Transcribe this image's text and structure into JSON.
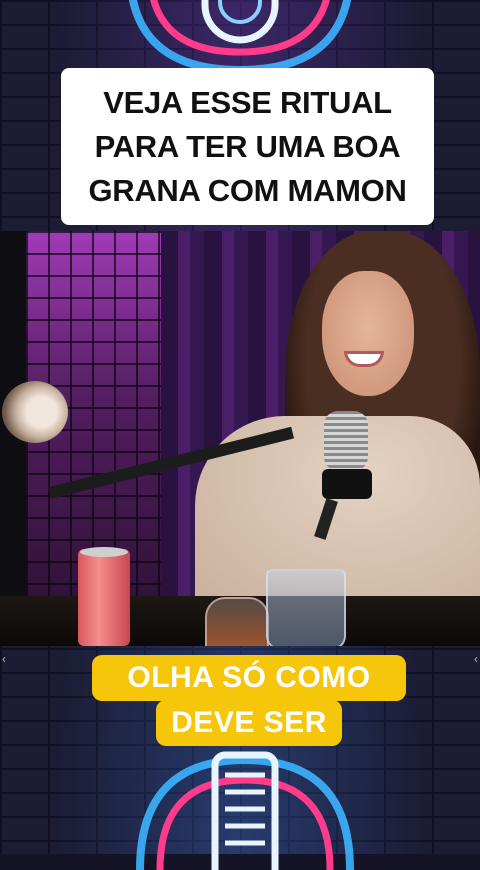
{
  "title_card": {
    "text": "VEJA ESSE RITUAL\nPARA TER UMA BOA\nGRANA COM MAMON"
  },
  "caption": {
    "line1": "OLHA SÓ COMO",
    "line2": "DEVE SER"
  },
  "colors": {
    "caption_bg": "#f6c60a",
    "caption_text": "#ffffff",
    "title_bg": "#ffffff",
    "neon_pink": "#ff3c8c",
    "neon_blue": "#3cb4ff",
    "neon_white": "#e8f4ff"
  },
  "icons": {
    "left": "chevron-left-icon",
    "right": "chevron-right-icon",
    "neon_top": "microphone-neon-icon",
    "neon_bottom": "microphone-neon-icon"
  }
}
